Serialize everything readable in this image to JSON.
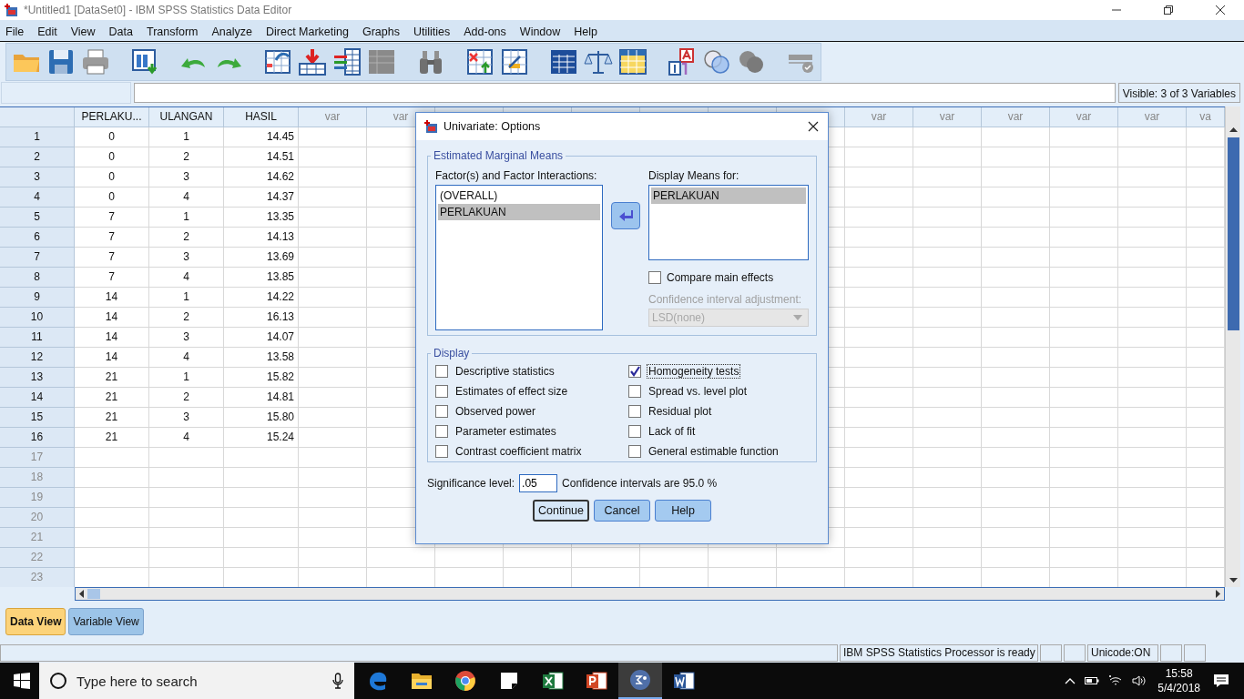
{
  "window": {
    "title": "*Untitled1 [DataSet0] - IBM SPSS Statistics Data Editor"
  },
  "menu": [
    "File",
    "Edit",
    "View",
    "Data",
    "Transform",
    "Analyze",
    "Direct Marketing",
    "Graphs",
    "Utilities",
    "Add-ons",
    "Window",
    "Help"
  ],
  "visible_info": "Visible: 3 of 3 Variables",
  "grid": {
    "columns": [
      "PERLAKU...",
      "ULANGAN",
      "HASIL",
      "var",
      "var",
      "var",
      "var",
      "var",
      "var",
      "var",
      "va"
    ],
    "rows": [
      {
        "number": "1",
        "cells": [
          "0",
          "1",
          "14.45"
        ]
      },
      {
        "number": "2",
        "cells": [
          "0",
          "2",
          "14.51"
        ]
      },
      {
        "number": "3",
        "cells": [
          "0",
          "3",
          "14.62"
        ]
      },
      {
        "number": "4",
        "cells": [
          "0",
          "4",
          "14.37"
        ]
      },
      {
        "number": "5",
        "cells": [
          "7",
          "1",
          "13.35"
        ]
      },
      {
        "number": "6",
        "cells": [
          "7",
          "2",
          "14.13"
        ]
      },
      {
        "number": "7",
        "cells": [
          "7",
          "3",
          "13.69"
        ]
      },
      {
        "number": "8",
        "cells": [
          "7",
          "4",
          "13.85"
        ]
      },
      {
        "number": "9",
        "cells": [
          "14",
          "1",
          "14.22"
        ]
      },
      {
        "number": "10",
        "cells": [
          "14",
          "2",
          "16.13"
        ]
      },
      {
        "number": "11",
        "cells": [
          "14",
          "3",
          "14.07"
        ]
      },
      {
        "number": "12",
        "cells": [
          "14",
          "4",
          "13.58"
        ]
      },
      {
        "number": "13",
        "cells": [
          "21",
          "1",
          "15.82"
        ]
      },
      {
        "number": "14",
        "cells": [
          "21",
          "2",
          "14.81"
        ]
      },
      {
        "number": "15",
        "cells": [
          "21",
          "3",
          "15.80"
        ]
      },
      {
        "number": "16",
        "cells": [
          "21",
          "4",
          "15.24"
        ]
      },
      {
        "number": "17"
      },
      {
        "number": "18"
      },
      {
        "number": "19"
      },
      {
        "number": "20"
      },
      {
        "number": "21"
      },
      {
        "number": "22"
      },
      {
        "number": "23"
      }
    ]
  },
  "view_tabs": [
    {
      "label": "Data View",
      "selected": true
    },
    {
      "label": "Variable View",
      "selected": false
    }
  ],
  "status_bar": {
    "message": "IBM SPSS Statistics Processor is ready",
    "encoding": "Unicode:ON"
  },
  "dialog": {
    "title": "Univariate: Options",
    "emm": {
      "legend": "Estimated Marginal Means",
      "factors_label": "Factor(s) and Factor Interactions:",
      "factors": [
        {
          "label": "(OVERALL)",
          "selected": false
        },
        {
          "label": "PERLAKUAN",
          "selected": true
        }
      ],
      "display_label": "Display Means for:",
      "display_items": [
        {
          "label": "PERLAKUAN",
          "selected": true
        }
      ],
      "compare": {
        "label": "Compare main effects",
        "checked": false
      },
      "adjustment": {
        "label": "Confidence interval adjustment:",
        "value": "LSD(none)",
        "disabled": true
      }
    },
    "display": {
      "legend": "Display",
      "options": [
        {
          "label": "Descriptive statistics",
          "checked": false,
          "focused": false
        },
        {
          "label": "Homogeneity tests",
          "checked": true,
          "focused": true
        },
        {
          "label": "Estimates of effect size",
          "checked": false,
          "focused": false
        },
        {
          "label": "Spread vs. level plot",
          "checked": false,
          "focused": false
        },
        {
          "label": "Observed power",
          "checked": false,
          "focused": false
        },
        {
          "label": "Residual plot",
          "checked": false,
          "focused": false
        },
        {
          "label": "Parameter estimates",
          "checked": false,
          "focused": false
        },
        {
          "label": "Lack of fit",
          "checked": false,
          "focused": false
        },
        {
          "label": "Contrast coefficient matrix",
          "checked": false,
          "focused": false
        },
        {
          "label": "General estimable function",
          "checked": false,
          "focused": false
        }
      ]
    },
    "significance_label": "Significance level:",
    "significance_value": ".05",
    "ci_text": "Confidence intervals are 95.0 %",
    "buttons": [
      {
        "label": "Continue",
        "default": true
      },
      {
        "label": "Cancel",
        "default": false
      },
      {
        "label": "Help",
        "default": false
      }
    ]
  },
  "taskbar": {
    "search_placeholder": "Type here to search",
    "time": "15:58",
    "date": "5/4/2018"
  }
}
